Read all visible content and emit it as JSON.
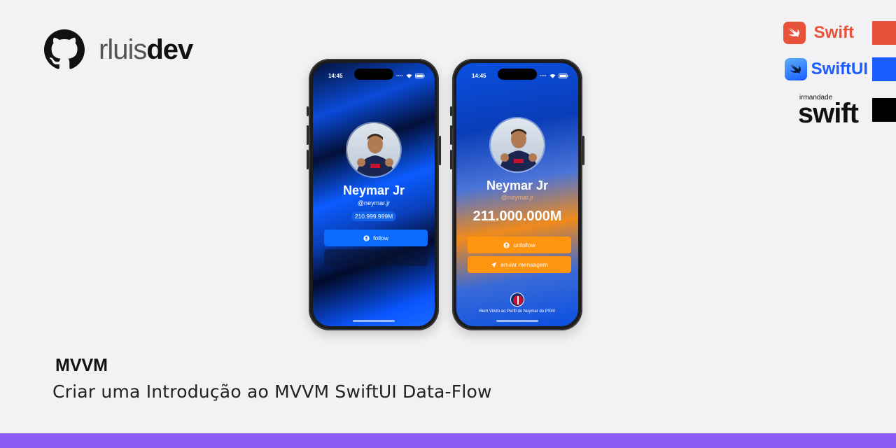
{
  "brand": {
    "light": "rluis",
    "bold": "dev"
  },
  "tech_badges": [
    {
      "label": "Swift",
      "color": "#e8523a",
      "icon": "swift-bird-icon"
    },
    {
      "label": "SwiftUI",
      "color": "#1a5cff",
      "icon": "swiftui-bird-icon"
    },
    {
      "small": "irmandade",
      "big": "swift",
      "color": "#000000"
    }
  ],
  "phones": [
    {
      "time": "14:45",
      "name": "Neymar Jr",
      "handle": "@neymar.jr",
      "followers": "210.999.999M",
      "primary_button": "follow"
    },
    {
      "time": "14:45",
      "name": "Neymar Jr",
      "handle": "@neymar.jr",
      "followers": "211.000.000M",
      "primary_button": "unfollow",
      "secondary_button": "enviar mensagem",
      "footer": "Bem Vindo ao Perfil do Neymar do PSG!"
    }
  ],
  "content": {
    "title": "MVVM",
    "subtitle": "Criar uma Introdução ao MVVM SwiftUI Data-Flow"
  },
  "colors": {
    "background": "#f2f2f4",
    "bottom_bar": "#8c5cf6"
  }
}
